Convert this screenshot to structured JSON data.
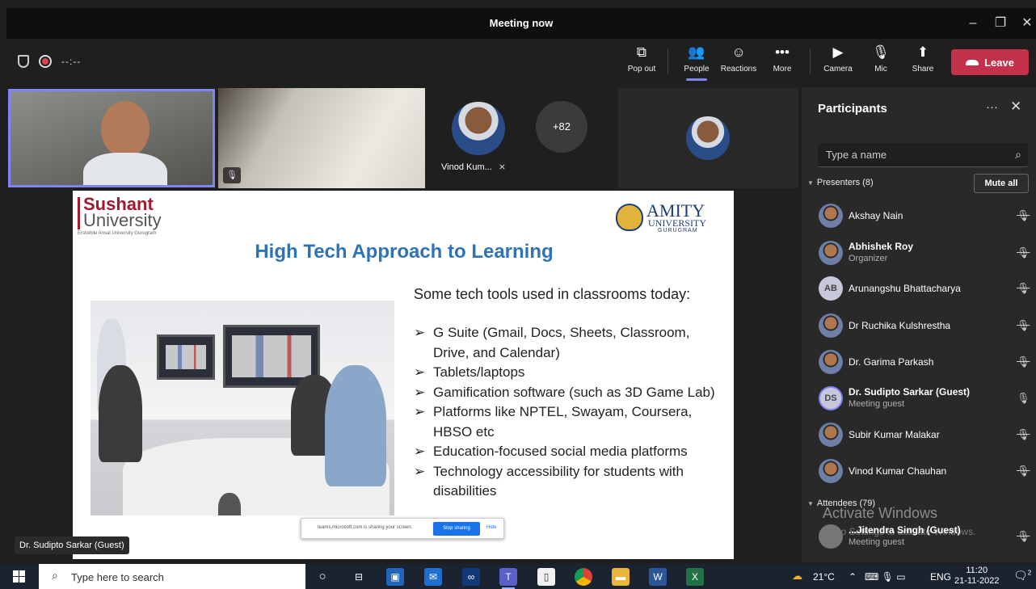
{
  "window": {
    "title": "Meeting now"
  },
  "toolbar": {
    "timer": "--:--",
    "popout_label": "Pop out",
    "people_label": "People",
    "reactions_label": "Reactions",
    "more_label": "More",
    "camera_label": "Camera",
    "mic_label": "Mic",
    "share_label": "Share",
    "leave_label": "Leave"
  },
  "videos": {
    "overflow_count": "+82",
    "vinod_name": "Vinod Kum..."
  },
  "slide": {
    "su_logo_line1": "Sushant",
    "su_logo_line2": "University",
    "su_logo_tagline": "Erstwhile Ansal University Gurugram",
    "amity_line1": "AMITY",
    "amity_line2": "UNIVERSITY",
    "amity_line3": "GURUGRAM",
    "title": "High Tech Approach to Learning",
    "intro": "Some tech tools used in classrooms today:",
    "bullets": [
      "G Suite (Gmail, Docs, Sheets, Classroom, Drive, and Calendar)",
      "Tablets/laptops",
      "Gamification software (such as 3D Game Lab)",
      "Platforms like NPTEL, Swayam, Coursera, HBSO etc",
      "Education-focused social media platforms",
      "Technology accessibility for students with disabilities"
    ]
  },
  "share_bar": {
    "message": "teams.microsoft.com is sharing your screen.",
    "stop_label": "Stop sharing",
    "hide_label": "Hide"
  },
  "presenter_label": "Dr. Sudipto Sarkar (Guest)",
  "panel": {
    "title": "Participants",
    "search_placeholder": "Type a name",
    "presenters_header": "Presenters (8)",
    "mute_all_label": "Mute all",
    "attendees_header": "Attendees (79)",
    "presenters": [
      {
        "name": "Akshay Nain",
        "sub": "",
        "avatar": "photo",
        "initials": ""
      },
      {
        "name": "Abhishek Roy",
        "sub": "Organizer",
        "avatar": "photo",
        "initials": ""
      },
      {
        "name": "Arunangshu Bhattacharya",
        "sub": "",
        "avatar": "initials",
        "initials": "AB"
      },
      {
        "name": "Dr Ruchika Kulshrestha",
        "sub": "",
        "avatar": "photo",
        "initials": ""
      },
      {
        "name": "Dr. Garima Parkash",
        "sub": "",
        "avatar": "photo",
        "initials": ""
      },
      {
        "name": "Dr. Sudipto Sarkar (Guest)",
        "sub": "Meeting guest",
        "avatar": "initials",
        "initials": "DS"
      },
      {
        "name": "Subir Kumar Malakar",
        "sub": "",
        "avatar": "photo",
        "initials": ""
      },
      {
        "name": "Vinod Kumar Chauhan",
        "sub": "",
        "avatar": "photo",
        "initials": ""
      }
    ],
    "attendee": {
      "name": "...Jitendra Singh (Guest)",
      "sub": "Meeting guest"
    },
    "watermark_title": "Activate Windows",
    "watermark_sub": "Go to Settings to activate Windows."
  },
  "taskbar": {
    "search_placeholder": "Type here to search",
    "weather": "21°C",
    "language": "ENG",
    "time": "11:20",
    "date": "21-11-2022",
    "notification_count": "2"
  },
  "colors": {
    "accent": "#7f85f5",
    "leave": "#c4314b",
    "slide_title": "#2e74b5"
  }
}
